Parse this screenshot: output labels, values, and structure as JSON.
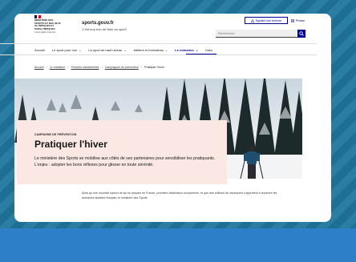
{
  "header": {
    "logo_lines": "MINISTÈRE DES SPORTS ET DES JEUX OLYMPIQUES ET PARALYMPIQUES",
    "logo_motto": "Liberté Égalité Fraternité",
    "site_title": "sports.gouv.fr",
    "site_tagline": "C'est trop bon de faire du sport!",
    "report_button": "Signaler une violence",
    "press_link": "Presse",
    "search_placeholder": "Rechercher"
  },
  "nav": {
    "items": [
      {
        "label": "Accueil"
      },
      {
        "label": "Le sport pour moi"
      },
      {
        "label": "Le sport de haut niveau"
      },
      {
        "label": "Métiers et formations"
      },
      {
        "label": "Le ministère"
      },
      {
        "label": "Data"
      }
    ],
    "active_index": 4
  },
  "breadcrumb": {
    "items": [
      "Accueil",
      "Le ministère",
      "Priorités ministérielles",
      "Campagnes de prévention",
      "Pratiquer l'hiver"
    ]
  },
  "hero": {
    "kicker": "CAMPAGNE DE PRÉVENTION",
    "title": "Pratiquer l'hiver",
    "description": "Le ministère des Sports se mobilise aux côtés de ses partenaires pour sensibiliser les pratiquants. L'enjeu : adopter les bons réflexes pour glisser en toute sérénité."
  },
  "article": {
    "intro": "Alors qu'une nouvelle saison de ski se prépare en France, première destination européenne, et que des millions de vacanciers s'apprêtent à rejoindre les domaines skiables français, le ministère des Sports"
  },
  "colors": {
    "accent": "#000091",
    "card_bg": "#fbe8e3",
    "frame_bg": "#1f6f94",
    "band": "#2d7fc7"
  }
}
